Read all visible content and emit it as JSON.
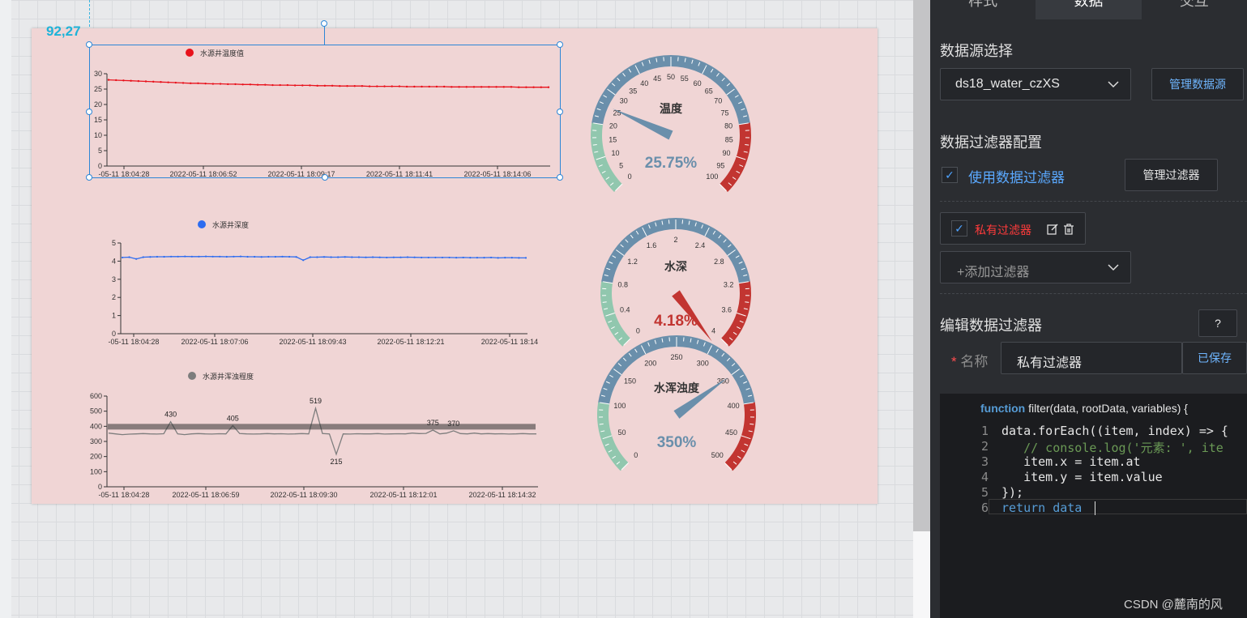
{
  "coord_label": "92,27",
  "panel": {
    "tabs": [
      "样式",
      "数据",
      "交互"
    ],
    "datasource_title": "数据源选择",
    "datasource_value": "ds18_water_czXS",
    "manage_datasource": "管理数据源",
    "filter_config_title": "数据过滤器配置",
    "use_filter_label": "使用数据过滤器",
    "manage_filter": "管理过滤器",
    "private_filter_label": "私有过滤器",
    "add_filter": "+添加过滤器",
    "edit_filter_title": "编辑数据过滤器",
    "help": "?",
    "name_label": "名称",
    "name_value": "私有过滤器",
    "saved": "已保存",
    "function_sig_kw": "function",
    "function_sig_rest": " filter(data, rootData, variables) {",
    "code_lines": [
      "data.forEach((item, index) => {",
      "   // console.log('元素: ', ite",
      "   item.x = item.at",
      "   item.y = item.value",
      "});",
      "return data "
    ],
    "line_numbers": [
      "1",
      "2",
      "3",
      "4",
      "5",
      "6"
    ]
  },
  "watermark": "CSDN @麓南的风",
  "colors": {
    "temp": "#e8121c",
    "depth": "#2d6cf0",
    "turbidity": "#7d7d7d",
    "gauge_blue": "#6a8fab",
    "gauge_green": "#91c7ae",
    "gauge_red": "#c23531"
  },
  "chart_data": [
    {
      "type": "line",
      "series": [
        {
          "name": "水源井温度值",
          "values": [
            28,
            27.9,
            27.8,
            27.7,
            27.6,
            27.5,
            27.4,
            27.3,
            27.2,
            27.1,
            27.0,
            26.9,
            26.9,
            26.8,
            26.7,
            26.7,
            26.6,
            26.6,
            26.5,
            26.5,
            26.4,
            26.4,
            26.3,
            26.3,
            26.3,
            26.2,
            26.2,
            26.2,
            26.1,
            26.1,
            26.1,
            26.0,
            26.0,
            26.0,
            26.0,
            25.9,
            25.9,
            25.9,
            25.9,
            25.9,
            25.8,
            25.8,
            25.8,
            25.8,
            25.8,
            25.8,
            25.7,
            25.7,
            25.7,
            25.7,
            25.7,
            25.7,
            25.7,
            25.7,
            25.7,
            25.6,
            25.6,
            25.6,
            25.6,
            25.6
          ]
        }
      ],
      "x_ticks": [
        "-05-11 18:04:28",
        "2022-05-11 18:06:52",
        "2022-05-11 18:09:17",
        "2022-05-11 18:11:41",
        "2022-05-11 18:14:06"
      ],
      "y_ticks": [
        "0",
        "5",
        "10",
        "15",
        "20",
        "25",
        "30"
      ],
      "ylim": [
        0,
        30
      ]
    },
    {
      "type": "line",
      "series": [
        {
          "name": "水源井深度",
          "values": [
            4.2,
            4.22,
            4.12,
            4.22,
            4.23,
            4.24,
            4.24,
            4.25,
            4.25,
            4.26,
            4.25,
            4.25,
            4.26,
            4.25,
            4.25,
            4.24,
            4.25,
            4.26,
            4.24,
            4.24,
            4.23,
            4.24,
            4.24,
            4.25,
            4.24,
            4.23,
            4.05,
            4.22,
            4.22,
            4.23,
            4.22,
            4.22,
            4.23,
            4.22,
            4.22,
            4.21,
            4.22,
            4.21,
            4.2,
            4.21,
            4.21,
            4.22,
            4.21,
            4.2,
            4.2,
            4.2,
            4.2,
            4.2,
            4.19,
            4.2,
            4.19,
            4.19,
            4.19,
            4.2,
            4.18,
            4.19,
            4.19,
            4.18,
            4.18
          ]
        }
      ],
      "x_ticks": [
        "-05-11 18:04:28",
        "2022-05-11 18:07:06",
        "2022-05-11 18:09:43",
        "2022-05-11 18:12:21",
        "2022-05-11 18:14"
      ],
      "y_ticks": [
        "0",
        "1",
        "2",
        "3",
        "4",
        "5"
      ],
      "ylim": [
        0,
        5
      ]
    },
    {
      "type": "line",
      "series": [
        {
          "name": "水源井浑浊程度",
          "values": [
            355,
            350,
            345,
            348,
            350,
            352,
            350,
            349,
            351,
            430,
            350,
            345,
            350,
            352,
            350,
            349,
            351,
            350,
            405,
            352,
            350,
            349,
            350,
            352,
            350,
            351,
            349,
            350,
            352,
            350,
            519,
            352,
            350,
            215,
            350,
            349,
            351,
            350,
            350,
            352,
            349,
            350,
            351,
            350,
            355,
            352,
            353,
            375,
            350,
            355,
            370,
            352,
            350,
            355,
            350,
            352,
            350,
            351,
            349,
            350,
            352,
            350,
            350
          ]
        }
      ],
      "labels": [
        "430",
        "405",
        "519",
        "215",
        "375",
        "370"
      ],
      "x_ticks": [
        "-05-11 18:04:28",
        "2022-05-11 18:06:59",
        "2022-05-11 18:09:30",
        "2022-05-11 18:12:01",
        "2022-05-11 18:14:32"
      ],
      "y_ticks": [
        "0",
        "100",
        "200",
        "300",
        "400",
        "500",
        "600"
      ],
      "ylim": [
        0,
        600
      ]
    },
    {
      "type": "gauge",
      "title": "温度",
      "value": 25.75,
      "value_label": "25.75%",
      "min": 0,
      "max": 100,
      "ticks": [
        "0",
        "5",
        "10",
        "15",
        "20",
        "25",
        "30",
        "35",
        "40",
        "45",
        "50",
        "55",
        "60",
        "65",
        "70",
        "75",
        "80",
        "85",
        "90",
        "95",
        "100"
      ]
    },
    {
      "type": "gauge",
      "title": "水深",
      "value": 4.18,
      "value_label": "4.18%",
      "min": 0,
      "max": 4,
      "ticks": [
        "0",
        "0.4",
        "0.8",
        "1.2",
        "1.6",
        "2",
        "2.4",
        "2.8",
        "3.2",
        "3.6",
        "4"
      ]
    },
    {
      "type": "gauge",
      "title": "水浑浊度",
      "value": 350,
      "value_label": "350%",
      "min": 0,
      "max": 500,
      "ticks": [
        "0",
        "50",
        "100",
        "150",
        "200",
        "250",
        "300",
        "350",
        "400",
        "450",
        "500"
      ]
    }
  ]
}
